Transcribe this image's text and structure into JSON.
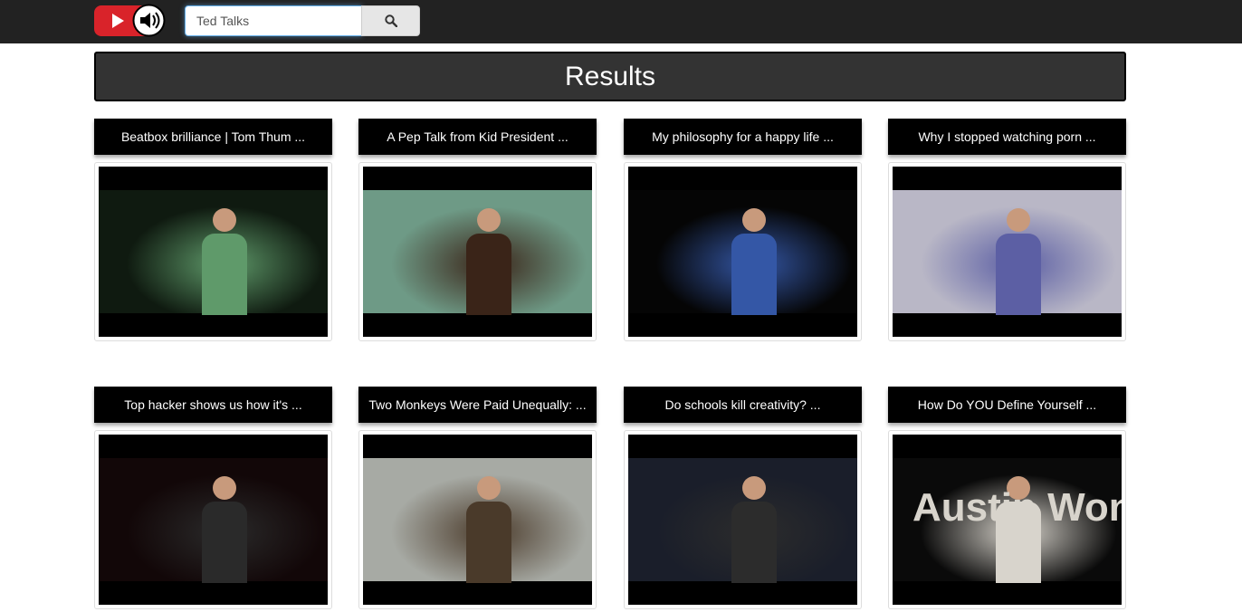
{
  "search": {
    "value": "Ted Talks"
  },
  "results": {
    "heading": "Results",
    "videos": [
      {
        "title": "Beatbox brilliance | Tom Thum ...",
        "scene_bg": "#0f1a10",
        "accent": "#5f9a6a"
      },
      {
        "title": "A Pep Talk from Kid President ...",
        "scene_bg": "#6e9a86",
        "accent": "#3a2418"
      },
      {
        "title": "My philosophy for a happy life ...",
        "scene_bg": "#050505",
        "accent": "#3457a6"
      },
      {
        "title": "Why I stopped watching porn ...",
        "scene_bg": "#b9b7c6",
        "accent": "#5c5fa4"
      },
      {
        "title": "Top hacker shows us how it's ...",
        "scene_bg": "#120708",
        "accent": "#2a2a2a"
      },
      {
        "title": "Two Monkeys Were Paid Unequally: ...",
        "scene_bg": "#a7aaa4",
        "accent": "#4a3a2a"
      },
      {
        "title": "Do schools kill creativity? ...",
        "scene_bg": "#1a1e2a",
        "accent": "#2c2c2c"
      },
      {
        "title": "How Do YOU Define Yourself ...",
        "scene_bg": "#0a0a0a",
        "accent": "#d8d4cc",
        "overlay_text": "Austin Won"
      }
    ]
  }
}
